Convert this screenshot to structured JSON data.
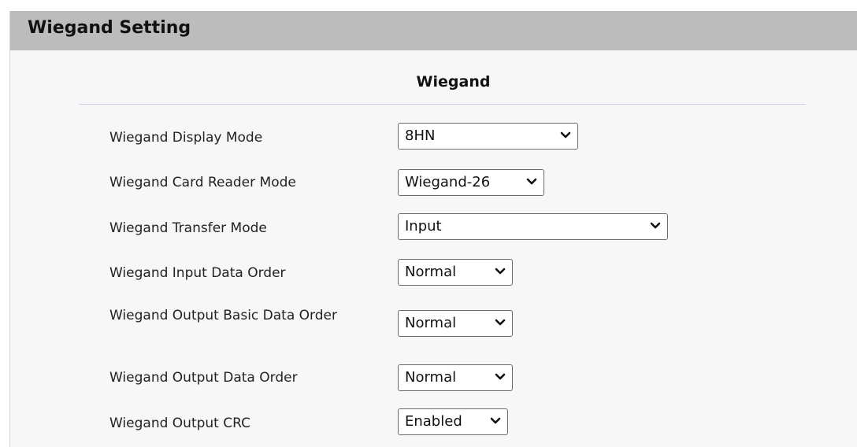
{
  "panel": {
    "title": "Wiegand Setting"
  },
  "section": {
    "title": "Wiegand"
  },
  "fields": [
    {
      "label": "Wiegand Display Mode",
      "value": "8HN"
    },
    {
      "label": "Wiegand Card Reader Mode",
      "value": "Wiegand-26"
    },
    {
      "label": "Wiegand Transfer Mode",
      "value": "Input"
    },
    {
      "label": "Wiegand Input Data Order",
      "value": "Normal"
    },
    {
      "label": "Wiegand Output Basic Data Order",
      "value": "Normal"
    },
    {
      "label": "Wiegand Output Data Order",
      "value": "Normal"
    },
    {
      "label": "Wiegand Output CRC",
      "value": "Enabled"
    }
  ],
  "icons": {
    "dropdown": "chevron-down-icon"
  },
  "colors": {
    "header_background": "#bcbcbc",
    "panel_background": "#f7f7f7",
    "divider": "#c9d3e3",
    "select_border": "#6b6b6b"
  }
}
